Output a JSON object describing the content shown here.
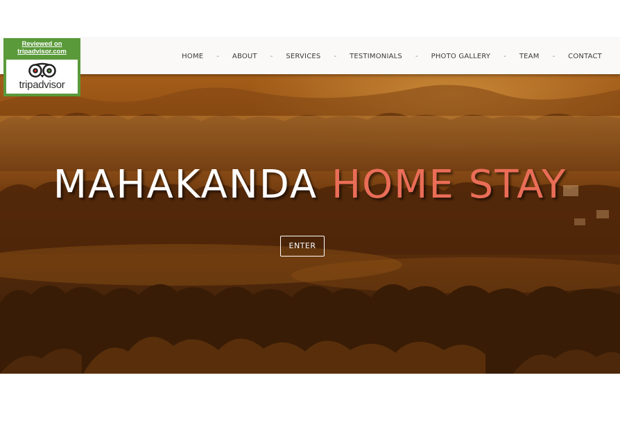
{
  "tripadvisor_badge": {
    "reviewed_line1": "Reviewed on",
    "reviewed_line2": "tripadvisor.com",
    "wordmark_trip": "trip",
    "wordmark_advisor": "advisor",
    "brand_color": "#5a9a3a",
    "icon": "tripadvisor-owl-icon"
  },
  "nav": {
    "items": [
      {
        "label": "HOME"
      },
      {
        "label": "ABOUT"
      },
      {
        "label": "SERVICES"
      },
      {
        "label": "TESTIMONIALS"
      },
      {
        "label": "PHOTO GALLERY"
      },
      {
        "label": "TEAM"
      },
      {
        "label": "CONTACT"
      }
    ],
    "separator": "-"
  },
  "hero": {
    "title_part1": "MAHAKANDA",
    "title_part2": "HOME STAY",
    "title_accent_color": "#ea6d57",
    "cta_label": "ENTER"
  }
}
